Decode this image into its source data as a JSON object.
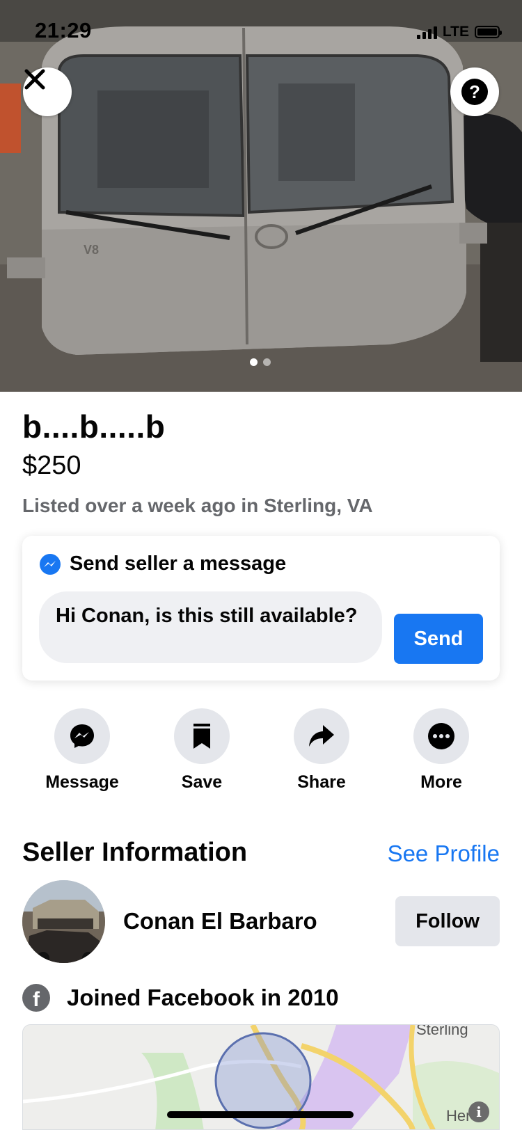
{
  "status_bar": {
    "time": "21:29",
    "network": "LTE"
  },
  "hero": {
    "close_icon": "close-icon",
    "help_icon": "question-icon",
    "help_glyph": "?",
    "image_count": 2,
    "active_image": 1
  },
  "listing": {
    "title": "b....b.....b",
    "price": "$250",
    "listed": "Listed over a week ago in Sterling, VA"
  },
  "message_card": {
    "heading": "Send seller a message",
    "icon": "messenger-icon",
    "input_value": "Hi Conan, is this still available?",
    "send_label": "Send"
  },
  "actions": [
    {
      "label": "Message",
      "icon": "messenger-icon"
    },
    {
      "label": "Save",
      "icon": "bookmark-icon"
    },
    {
      "label": "Share",
      "icon": "share-arrow-icon"
    },
    {
      "label": "More",
      "icon": "more-icon"
    }
  ],
  "seller": {
    "heading": "Seller Information",
    "see_profile": "See Profile",
    "name": "Conan El Barbaro",
    "follow_label": "Follow",
    "joined": "Joined Facebook in 2010",
    "fb_glyph": "f"
  },
  "map": {
    "label_top": "Sterling",
    "label_bottom": "Her",
    "info_glyph": "i"
  },
  "colors": {
    "accent": "#1877f2",
    "secondary_text": "#65676b",
    "button_gray": "#e4e6eb",
    "input_bg": "#eff0f3"
  }
}
